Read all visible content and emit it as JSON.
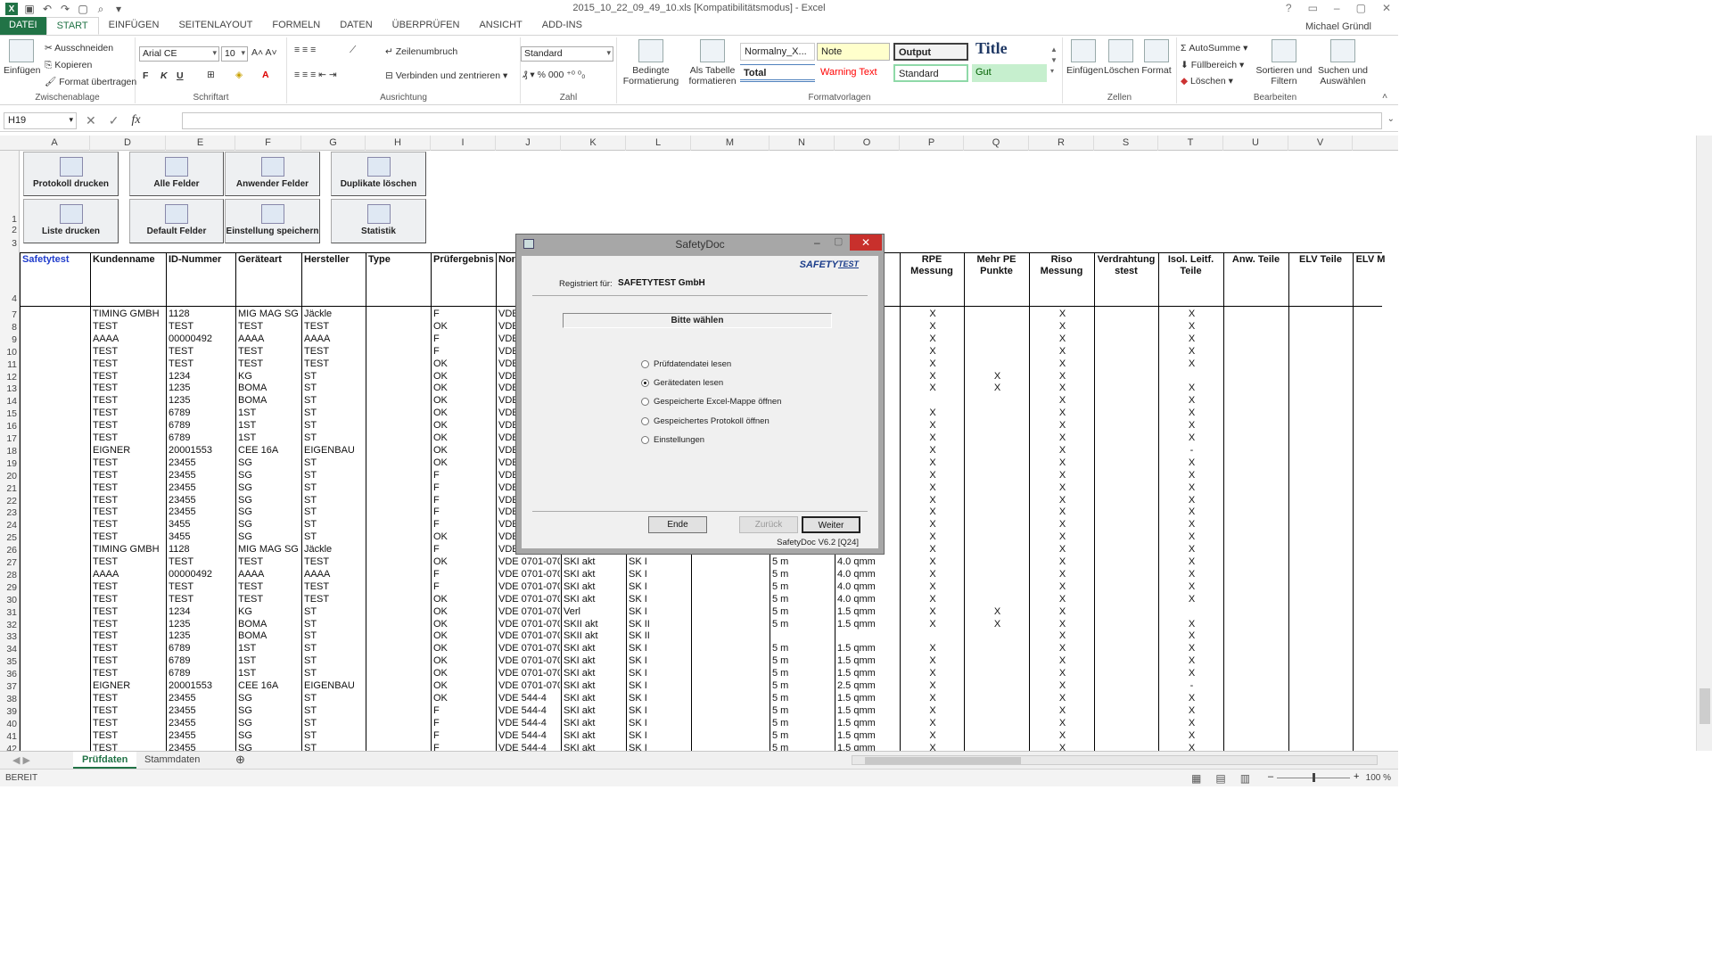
{
  "window": {
    "title": "2015_10_22_09_49_10.xls  [Kompatibilitätsmodus] - Excel",
    "user": "Michael Gründl"
  },
  "ribbon_tabs": [
    "DATEI",
    "START",
    "EINFÜGEN",
    "SEITENLAYOUT",
    "FORMELN",
    "DATEN",
    "ÜBERPRÜFEN",
    "ANSICHT",
    "ADD-INS"
  ],
  "ribbon": {
    "clipboard": {
      "paste": "Einfügen",
      "cut": "Ausschneiden",
      "copy": "Kopieren",
      "format_painter": "Format übertragen",
      "label": "Zwischenablage"
    },
    "font": {
      "name": "Arial CE",
      "size": "10",
      "label": "Schriftart"
    },
    "alignment": {
      "wrap": "Zeilenumbruch",
      "merge": "Verbinden und zentrieren",
      "label": "Ausrichtung"
    },
    "number": {
      "format": "Standard",
      "label": "Zahl"
    },
    "styles": {
      "cond_format": "Bedingte Formatierung",
      "as_table": "Als Tabelle formatieren",
      "label": "Formatvorlagen",
      "cells": [
        "Normalny_X...",
        "Note",
        "Output",
        "Title",
        "Total",
        "Warning Text",
        "Standard",
        "Gut"
      ]
    },
    "cells": {
      "insert": "Einfügen",
      "delete": "Löschen",
      "format": "Format",
      "label": "Zellen"
    },
    "editing": {
      "autosum": "AutoSumme",
      "fill": "Füllbereich",
      "clear": "Löschen",
      "sort": "Sortieren und Filtern",
      "find": "Suchen und Auswählen",
      "label": "Bearbeiten"
    }
  },
  "formula_bar": {
    "name_box": "H19",
    "formula": ""
  },
  "columns": [
    "A",
    "D",
    "E",
    "F",
    "G",
    "H",
    "I",
    "J",
    "K",
    "L",
    "M",
    "N",
    "O",
    "P",
    "Q",
    "R",
    "S",
    "T",
    "U",
    "V"
  ],
  "row_numbers": [
    "1",
    "2",
    "3",
    "4",
    "7",
    "8",
    "9",
    "10",
    "11",
    "12",
    "13",
    "14",
    "15",
    "16",
    "17",
    "18",
    "19",
    "20",
    "21",
    "22",
    "23",
    "24",
    "25",
    "26",
    "27",
    "28",
    "29",
    "30",
    "31",
    "32",
    "33",
    "34",
    "35",
    "36",
    "37",
    "38",
    "39",
    "40",
    "41",
    "42"
  ],
  "macro_buttons": [
    {
      "label": "Protokoll drucken"
    },
    {
      "label": "Alle Felder"
    },
    {
      "label": "Anwender Felder"
    },
    {
      "label": "Duplikate löschen"
    },
    {
      "label": "Liste drucken"
    },
    {
      "label": "Default Felder"
    },
    {
      "label": "Einstellung speichern"
    },
    {
      "label": "Statistik"
    }
  ],
  "table_headers": {
    "A": "Safetytest",
    "D": "Kundenname",
    "E": "ID-Nummer",
    "F": "Geräteart",
    "G": "Hersteller",
    "H": "Type",
    "I": "Prüfergebnis",
    "J": "Nor",
    "O": "t",
    "P": "RPE Messung",
    "Q": "Mehr PE Punkte",
    "R": "Riso Messung",
    "S": "Verdrahtung stest",
    "T": "Isol. Leitf. Teile",
    "U": "Anw. Teile",
    "V": "ELV Teile",
    "W": "ELV M"
  },
  "rows": [
    {
      "n": "7",
      "D": "TIMING GMBH",
      "E": "1128",
      "F": "MIG MAG SG",
      "G": "Jäckle",
      "I": "F",
      "J": "VDE",
      "P": "X",
      "R": "X",
      "T": "X"
    },
    {
      "n": "8",
      "D": "TEST",
      "E": "TEST",
      "F": "TEST",
      "G": "TEST",
      "I": "OK",
      "J": "VDE",
      "P": "X",
      "R": "X",
      "T": "X"
    },
    {
      "n": "9",
      "D": "AAAA",
      "E": "00000492",
      "F": "AAAA",
      "G": "AAAA",
      "I": "F",
      "J": "VDE",
      "P": "X",
      "R": "X",
      "T": "X"
    },
    {
      "n": "10",
      "D": "TEST",
      "E": "TEST",
      "F": "TEST",
      "G": "TEST",
      "I": "F",
      "J": "VDE",
      "P": "X",
      "R": "X",
      "T": "X"
    },
    {
      "n": "11",
      "D": "TEST",
      "E": "TEST",
      "F": "TEST",
      "G": "TEST",
      "I": "OK",
      "J": "VDE",
      "P": "X",
      "R": "X",
      "T": "X"
    },
    {
      "n": "12",
      "D": "TEST",
      "E": "1234",
      "F": "KG",
      "G": "ST",
      "I": "OK",
      "J": "VDE",
      "P": "X",
      "Q": "X",
      "R": "X",
      "T": ""
    },
    {
      "n": "13",
      "D": "TEST",
      "E": "1235",
      "F": "BOMA",
      "G": "ST",
      "I": "OK",
      "J": "VDE",
      "P": "X",
      "Q": "X",
      "R": "X",
      "T": "X"
    },
    {
      "n": "14",
      "D": "TEST",
      "E": "1235",
      "F": "BOMA",
      "G": "ST",
      "I": "OK",
      "J": "VDE",
      "P": "",
      "R": "X",
      "T": "X"
    },
    {
      "n": "15",
      "D": "TEST",
      "E": "6789",
      "F": "1ST",
      "G": "ST",
      "I": "OK",
      "J": "VDE",
      "P": "X",
      "R": "X",
      "T": "X"
    },
    {
      "n": "16",
      "D": "TEST",
      "E": "6789",
      "F": "1ST",
      "G": "ST",
      "I": "OK",
      "J": "VDE",
      "P": "X",
      "R": "X",
      "T": "X"
    },
    {
      "n": "17",
      "D": "TEST",
      "E": "6789",
      "F": "1ST",
      "G": "ST",
      "I": "OK",
      "J": "VDE",
      "P": "X",
      "R": "X",
      "T": "X"
    },
    {
      "n": "18",
      "D": "EIGNER",
      "E": "20001553",
      "F": "CEE 16A",
      "G": "EIGENBAU",
      "I": "OK",
      "J": "VDE",
      "P": "X",
      "R": "X",
      "T": "-"
    },
    {
      "n": "19",
      "D": "TEST",
      "E": "23455",
      "F": "SG",
      "G": "ST",
      "I": "OK",
      "J": "VDE",
      "P": "X",
      "R": "X",
      "T": "X"
    },
    {
      "n": "20",
      "D": "TEST",
      "E": "23455",
      "F": "SG",
      "G": "ST",
      "I": "F",
      "J": "VDE",
      "P": "X",
      "R": "X",
      "T": "X"
    },
    {
      "n": "21",
      "D": "TEST",
      "E": "23455",
      "F": "SG",
      "G": "ST",
      "I": "F",
      "J": "VDE",
      "P": "X",
      "R": "X",
      "T": "X"
    },
    {
      "n": "22",
      "D": "TEST",
      "E": "23455",
      "F": "SG",
      "G": "ST",
      "I": "F",
      "J": "VDE",
      "P": "X",
      "R": "X",
      "T": "X"
    },
    {
      "n": "23",
      "D": "TEST",
      "E": "23455",
      "F": "SG",
      "G": "ST",
      "I": "F",
      "J": "VDE",
      "P": "X",
      "R": "X",
      "T": "X"
    },
    {
      "n": "24",
      "D": "TEST",
      "E": "3455",
      "F": "SG",
      "G": "ST",
      "I": "F",
      "J": "VDE",
      "P": "X",
      "R": "X",
      "T": "X"
    },
    {
      "n": "25",
      "D": "TEST",
      "E": "3455",
      "F": "SG",
      "G": "ST",
      "I": "OK",
      "J": "VDE",
      "P": "X",
      "R": "X",
      "T": "X"
    },
    {
      "n": "26",
      "D": "TIMING GMBH",
      "E": "1128",
      "F": "MIG MAG SG",
      "G": "Jäckle",
      "I": "F",
      "J": "VDE",
      "P": "X",
      "R": "X",
      "T": "X"
    },
    {
      "n": "27",
      "D": "TEST",
      "E": "TEST",
      "F": "TEST",
      "G": "TEST",
      "I": "OK",
      "J": "VDE 0701-070",
      "K": "SKI akt",
      "L": "SK I",
      "N": "5 m",
      "O": "4.0 qmm",
      "P": "X",
      "R": "X",
      "T": "X"
    },
    {
      "n": "28",
      "D": "AAAA",
      "E": "00000492",
      "F": "AAAA",
      "G": "AAAA",
      "I": "F",
      "J": "VDE 0701-070",
      "K": "SKI akt",
      "L": "SK I",
      "N": "5 m",
      "O": "4.0 qmm",
      "P": "X",
      "R": "X",
      "T": "X"
    },
    {
      "n": "29",
      "D": "TEST",
      "E": "TEST",
      "F": "TEST",
      "G": "TEST",
      "I": "F",
      "J": "VDE 0701-070",
      "K": "SKI akt",
      "L": "SK I",
      "N": "5 m",
      "O": "4.0 qmm",
      "P": "X",
      "R": "X",
      "T": "X"
    },
    {
      "n": "30",
      "D": "TEST",
      "E": "TEST",
      "F": "TEST",
      "G": "TEST",
      "I": "OK",
      "J": "VDE 0701-070",
      "K": "SKI akt",
      "L": "SK I",
      "N": "5 m",
      "O": "4.0 qmm",
      "P": "X",
      "R": "X",
      "T": "X"
    },
    {
      "n": "31",
      "D": "TEST",
      "E": "1234",
      "F": "KG",
      "G": "ST",
      "I": "OK",
      "J": "VDE 0701-070",
      "K": "Verl",
      "L": "SK I",
      "N": "5 m",
      "O": "1.5 qmm",
      "P": "X",
      "Q": "X",
      "R": "X",
      "T": ""
    },
    {
      "n": "32",
      "D": "TEST",
      "E": "1235",
      "F": "BOMA",
      "G": "ST",
      "I": "OK",
      "J": "VDE 0701-070",
      "K": "SKII akt",
      "L": "SK II",
      "N": "5 m",
      "O": "1.5 qmm",
      "P": "X",
      "Q": "X",
      "R": "X",
      "T": "X"
    },
    {
      "n": "33",
      "D": "TEST",
      "E": "1235",
      "F": "BOMA",
      "G": "ST",
      "I": "OK",
      "J": "VDE 0701-070",
      "K": "SKII akt",
      "L": "SK II",
      "N": "",
      "O": "",
      "P": "",
      "R": "X",
      "T": "X"
    },
    {
      "n": "34",
      "D": "TEST",
      "E": "6789",
      "F": "1ST",
      "G": "ST",
      "I": "OK",
      "J": "VDE 0701-070",
      "K": "SKI akt",
      "L": "SK I",
      "N": "5 m",
      "O": "1.5 qmm",
      "P": "X",
      "R": "X",
      "T": "X"
    },
    {
      "n": "35",
      "D": "TEST",
      "E": "6789",
      "F": "1ST",
      "G": "ST",
      "I": "OK",
      "J": "VDE 0701-070",
      "K": "SKI akt",
      "L": "SK I",
      "N": "5 m",
      "O": "1.5 qmm",
      "P": "X",
      "R": "X",
      "T": "X"
    },
    {
      "n": "36",
      "D": "TEST",
      "E": "6789",
      "F": "1ST",
      "G": "ST",
      "I": "OK",
      "J": "VDE 0701-070",
      "K": "SKI akt",
      "L": "SK I",
      "N": "5 m",
      "O": "1.5 qmm",
      "P": "X",
      "R": "X",
      "T": "X"
    },
    {
      "n": "37",
      "D": "EIGNER",
      "E": "20001553",
      "F": "CEE 16A",
      "G": "EIGENBAU",
      "I": "OK",
      "J": "VDE 0701-070",
      "K": "SKI akt",
      "L": "SK I",
      "N": "5 m",
      "O": "2.5 qmm",
      "P": "X",
      "R": "X",
      "T": "-"
    },
    {
      "n": "38",
      "D": "TEST",
      "E": "23455",
      "F": "SG",
      "G": "ST",
      "I": "OK",
      "J": "VDE 544-4",
      "K": "SKI akt",
      "L": "SK I",
      "N": "5 m",
      "O": "1.5 qmm",
      "P": "X",
      "R": "X",
      "T": "X"
    },
    {
      "n": "39",
      "D": "TEST",
      "E": "23455",
      "F": "SG",
      "G": "ST",
      "I": "F",
      "J": "VDE 544-4",
      "K": "SKI akt",
      "L": "SK I",
      "N": "5 m",
      "O": "1.5 qmm",
      "P": "X",
      "R": "X",
      "T": "X"
    },
    {
      "n": "40",
      "D": "TEST",
      "E": "23455",
      "F": "SG",
      "G": "ST",
      "I": "F",
      "J": "VDE 544-4",
      "K": "SKI akt",
      "L": "SK I",
      "N": "5 m",
      "O": "1.5 qmm",
      "P": "X",
      "R": "X",
      "T": "X"
    },
    {
      "n": "41",
      "D": "TEST",
      "E": "23455",
      "F": "SG",
      "G": "ST",
      "I": "F",
      "J": "VDE 544-4",
      "K": "SKI akt",
      "L": "SK I",
      "N": "5 m",
      "O": "1.5 qmm",
      "P": "X",
      "R": "X",
      "T": "X"
    },
    {
      "n": "42",
      "D": "TEST",
      "E": "23455",
      "F": "SG",
      "G": "ST",
      "I": "F",
      "J": "VDE 544-4",
      "K": "SKI akt",
      "L": "SK I",
      "N": "5 m",
      "O": "1.5 qmm",
      "P": "X",
      "R": "X",
      "T": "X"
    }
  ],
  "sheets": [
    "Prüfdaten",
    "Stammdaten"
  ],
  "status": {
    "text": "BEREIT",
    "zoom": "100 %",
    "zoom_level_percent": 100
  },
  "dialog": {
    "title": "SafetyDoc",
    "logo": "SAFETY",
    "logo_suffix": "TEST",
    "registered_label": "Registriert für:",
    "registered_value": "SAFETYTEST GmbH",
    "prompt": "Bitte wählen",
    "options": [
      {
        "label": "Prüfdatendatei lesen",
        "selected": false
      },
      {
        "label": "Gerätedaten lesen",
        "selected": true
      },
      {
        "label": "Gespeicherte Excel-Mappe öffnen",
        "selected": false
      },
      {
        "label": "Gespeichertes Protokoll öffnen",
        "selected": false
      },
      {
        "label": "Einstellungen",
        "selected": false
      }
    ],
    "buttons": {
      "end": "Ende",
      "back": "Zurück",
      "next": "Weiter"
    },
    "version": "SafetyDoc V6.2 [Q24]"
  },
  "colors": {
    "excel_green": "#217346",
    "dialog_close": "#c8302c",
    "header_blue": "#1f3ccc"
  }
}
